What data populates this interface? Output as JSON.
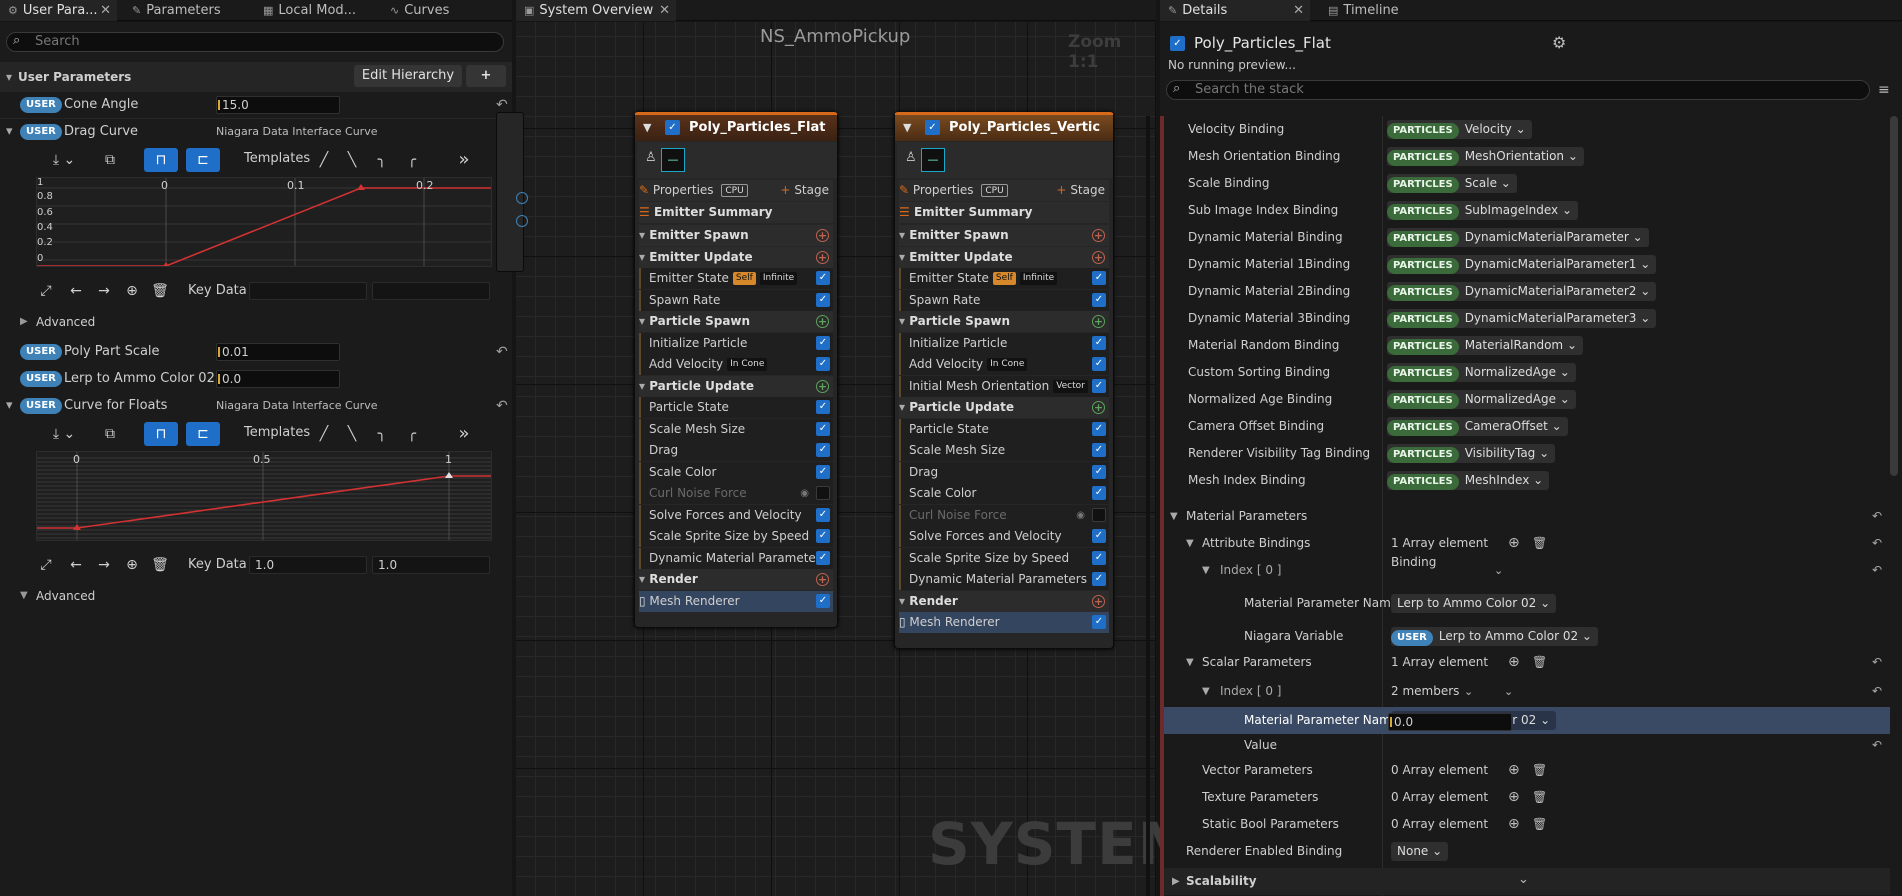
{
  "left_tabs": [
    {
      "label": "User Para...",
      "icon": "gear-icon"
    },
    {
      "label": "Parameters",
      "icon": "wrench-icon"
    },
    {
      "label": "Local Mod...",
      "icon": "module-icon"
    },
    {
      "label": "Curves",
      "icon": "curve-icon"
    }
  ],
  "left_search_placeholder": "Search",
  "user_params": {
    "header": "User Parameters",
    "edit_hierarchy": "Edit Hierarchy",
    "add": "+",
    "user_pill": "USER",
    "rows": {
      "cone_angle": {
        "label": "Cone Angle",
        "value": "15.0"
      },
      "drag_curve": {
        "label": "Drag Curve",
        "value": "Niagara Data Interface Curve"
      },
      "poly_part_scale": {
        "label": "Poly Part Scale",
        "value": "0.01"
      },
      "lerp_ammo": {
        "label": "Lerp to Ammo Color 02",
        "value": "0.0"
      },
      "curve_floats": {
        "label": "Curve for Floats",
        "value": "Niagara Data Interface Curve"
      }
    },
    "templates_label": "Templates",
    "key_data_label": "Key Data",
    "advanced_label": "Advanced",
    "curve1": {
      "x_ticks": [
        "0",
        "0.1",
        "0.2"
      ],
      "y_ticks": [
        "1",
        "0.8",
        "0.6",
        "0.4",
        "0.2",
        "0"
      ],
      "key_value_1": "",
      "key_value_2": ""
    },
    "curve2": {
      "x_ticks": [
        "0",
        "0.5",
        "1"
      ],
      "key_value_1": "1.0",
      "key_value_2": "1.0"
    }
  },
  "center": {
    "tab": "System Overview",
    "title": "NS_AmmoPickup",
    "zoom": "Zoom 1:1",
    "watermark": "SYSTEM",
    "node1": {
      "title": "Poly_Particles_Flat",
      "properties": "Properties",
      "cpu": "CPU",
      "stage": "Stage",
      "rows": [
        {
          "t": "sec",
          "label": "Emitter Summary"
        },
        {
          "t": "sub",
          "label": "Emitter Spawn"
        },
        {
          "t": "sub",
          "label": "Emitter Update"
        },
        {
          "t": "mod",
          "label": "Emitter State",
          "tags": [
            "Self",
            "Infinite"
          ]
        },
        {
          "t": "mod",
          "label": "Spawn Rate"
        },
        {
          "t": "sub",
          "label": "Particle Spawn"
        },
        {
          "t": "mod",
          "label": "Initialize Particle"
        },
        {
          "t": "mod",
          "label": "Add Velocity",
          "tags": [
            "In Cone"
          ]
        },
        {
          "t": "sub",
          "label": "Particle Update"
        },
        {
          "t": "mod",
          "label": "Particle State"
        },
        {
          "t": "mod",
          "label": "Scale Mesh Size"
        },
        {
          "t": "mod",
          "label": "Drag"
        },
        {
          "t": "mod",
          "label": "Scale Color"
        },
        {
          "t": "mod",
          "label": "Curl Noise Force",
          "off": true
        },
        {
          "t": "mod",
          "label": "Solve Forces and Velocity"
        },
        {
          "t": "mod",
          "label": "Scale Sprite Size by Speed"
        },
        {
          "t": "mod",
          "label": "Dynamic Material Parameters"
        },
        {
          "t": "sub",
          "label": "Render"
        },
        {
          "t": "render",
          "label": "Mesh Renderer"
        }
      ]
    },
    "node2": {
      "title": "Poly_Particles_Vertic",
      "properties": "Properties",
      "cpu": "CPU",
      "stage": "Stage",
      "rows": [
        {
          "t": "sec",
          "label": "Emitter Summary"
        },
        {
          "t": "sub",
          "label": "Emitter Spawn"
        },
        {
          "t": "sub",
          "label": "Emitter Update"
        },
        {
          "t": "mod",
          "label": "Emitter State",
          "tags": [
            "Self",
            "Infinite"
          ]
        },
        {
          "t": "mod",
          "label": "Spawn Rate"
        },
        {
          "t": "sub",
          "label": "Particle Spawn"
        },
        {
          "t": "mod",
          "label": "Initialize Particle"
        },
        {
          "t": "mod",
          "label": "Add Velocity",
          "tags": [
            "In Cone"
          ]
        },
        {
          "t": "mod",
          "label": "Initial Mesh Orientation",
          "tags": [
            "Vector"
          ]
        },
        {
          "t": "sub",
          "label": "Particle Update"
        },
        {
          "t": "mod",
          "label": "Particle State"
        },
        {
          "t": "mod",
          "label": "Scale Mesh Size"
        },
        {
          "t": "mod",
          "label": "Drag"
        },
        {
          "t": "mod",
          "label": "Scale Color"
        },
        {
          "t": "mod",
          "label": "Curl Noise Force",
          "off": true
        },
        {
          "t": "mod",
          "label": "Solve Forces and Velocity"
        },
        {
          "t": "mod",
          "label": "Scale Sprite Size by Speed"
        },
        {
          "t": "mod",
          "label": "Dynamic Material Parameters"
        },
        {
          "t": "sub",
          "label": "Render"
        },
        {
          "t": "render",
          "label": "Mesh Renderer"
        }
      ]
    }
  },
  "details": {
    "tab": "Details",
    "timeline_tab": "Timeline",
    "title": "Poly_Particles_Flat",
    "no_preview": "No running preview...",
    "search_placeholder": "Search the stack",
    "particles_pill": "PARTICLES",
    "bindings": [
      {
        "label": "Velocity Binding",
        "value": "Velocity"
      },
      {
        "label": "Mesh Orientation Binding",
        "value": "MeshOrientation"
      },
      {
        "label": "Scale Binding",
        "value": "Scale"
      },
      {
        "label": "Sub Image Index Binding",
        "value": "SubImageIndex"
      },
      {
        "label": "Dynamic Material Binding",
        "value": "DynamicMaterialParameter"
      },
      {
        "label": "Dynamic Material 1Binding",
        "value": "DynamicMaterialParameter1"
      },
      {
        "label": "Dynamic Material 2Binding",
        "value": "DynamicMaterialParameter2"
      },
      {
        "label": "Dynamic Material 3Binding",
        "value": "DynamicMaterialParameter3"
      },
      {
        "label": "Material Random Binding",
        "value": "MaterialRandom"
      },
      {
        "label": "Custom Sorting Binding",
        "value": "NormalizedAge"
      },
      {
        "label": "Normalized Age Binding",
        "value": "NormalizedAge"
      },
      {
        "label": "Camera Offset Binding",
        "value": "CameraOffset"
      },
      {
        "label": "Renderer Visibility Tag Binding",
        "value": "VisibilityTag"
      },
      {
        "label": "Mesh Index Binding",
        "value": "MeshIndex"
      }
    ],
    "material_parameters": "Material Parameters",
    "attribute_bindings": "Attribute Bindings",
    "attr_count": "1 Array element",
    "index0": "Index [ 0 ]",
    "binding": "Binding",
    "mat_param_name": "Material Parameter Name",
    "mat_param_value": "Lerp to Ammo Color 02",
    "niagara_variable": "Niagara Variable",
    "niagara_variable_value": "Lerp to Ammo Color 02",
    "user_pill": "USER",
    "scalar_parameters": "Scalar Parameters",
    "scalar_count": "1 Array element",
    "members": "2 members",
    "value_label": "Value",
    "value_value": "0.0",
    "vector_parameters": "Vector Parameters",
    "texture_parameters": "Texture Parameters",
    "static_bool_parameters": "Static Bool Parameters",
    "zero_array": "0 Array element",
    "renderer_enabled": "Renderer Enabled Binding",
    "none": "None",
    "scalability": "Scalability"
  }
}
